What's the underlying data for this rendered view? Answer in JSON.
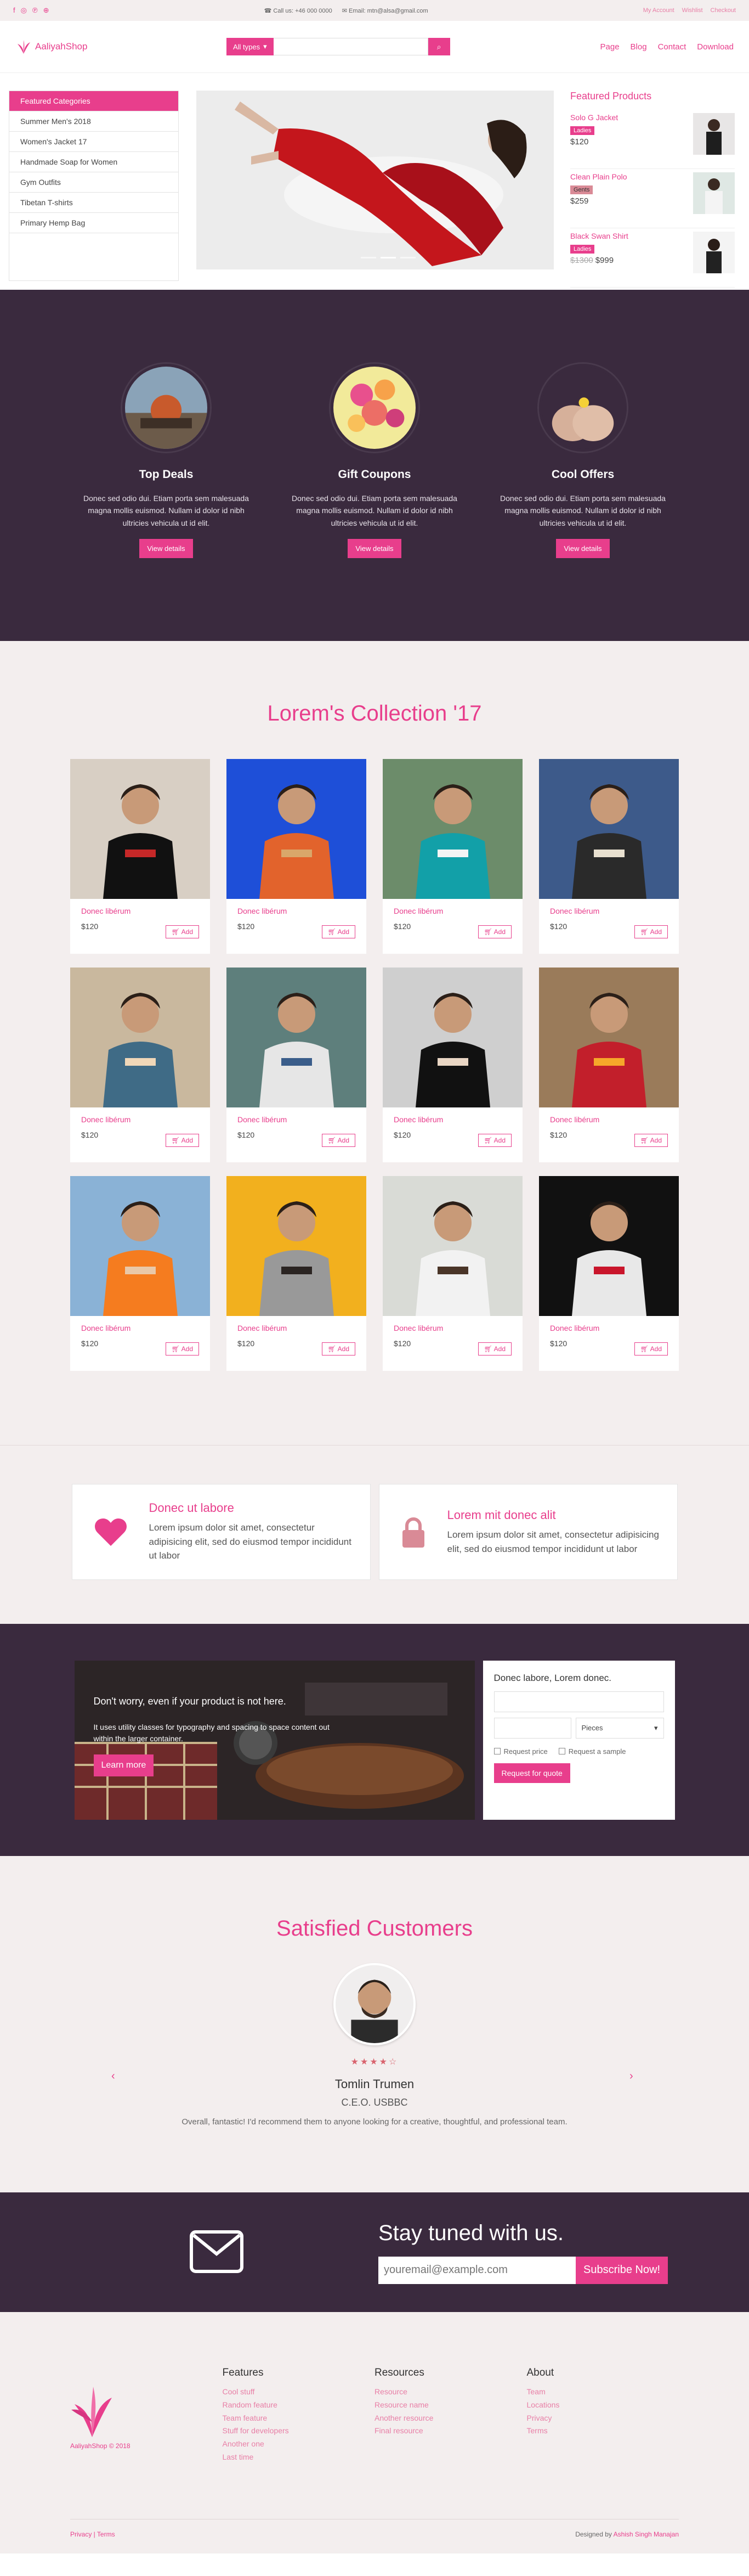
{
  "topbar": {
    "phone": "Call us: +46 000 0000",
    "email": "Email: mtn@alsa@gmail.com",
    "links": [
      "My Account",
      "Wishlist",
      "Checkout"
    ]
  },
  "header": {
    "logo": "AaliyahShop",
    "search_dropdown": "All types",
    "search_placeholder": "",
    "nav": [
      "Page",
      "Blog",
      "Contact",
      "Download"
    ]
  },
  "categories": {
    "items": [
      "Featured Categories",
      "Summer Men's 2018",
      "Women's Jacket 17",
      "Handmade Soap for Women",
      "Gym Outfits",
      "Tibetan T-shirts",
      "Primary Hemp Bag"
    ]
  },
  "featured": {
    "title": "Featured Products",
    "products": [
      {
        "name": "Solo G Jacket",
        "tag": "Ladies",
        "tag_color": "#e83e8c",
        "old_price": "",
        "price": "$120"
      },
      {
        "name": "Clean Plain Polo",
        "tag": "Gents",
        "tag_color": "#d98a96",
        "old_price": "",
        "price": "$259"
      },
      {
        "name": "Black Swan Shirt",
        "tag": "Ladies",
        "tag_color": "#e83e8c",
        "old_price": "$1300",
        "price": "$999"
      }
    ]
  },
  "deals": [
    {
      "title": "Top Deals",
      "text": "Donec sed odio dui. Etiam porta sem malesuada magna mollis euismod. Nullam id dolor id nibh ultricies vehicula ut id elit.",
      "button": "View details"
    },
    {
      "title": "Gift Coupons",
      "text": "Donec sed odio dui. Etiam porta sem malesuada magna mollis euismod. Nullam id dolor id nibh ultricies vehicula ut id elit.",
      "button": "View details"
    },
    {
      "title": "Cool Offers",
      "text": "Donec sed odio dui. Etiam porta sem malesuada magna mollis euismod. Nullam id dolor id nibh ultricies vehicula ut id elit.",
      "button": "View details"
    }
  ],
  "collection": {
    "title": "Lorem's Collection '17",
    "add_label": "Add",
    "items": [
      {
        "name": "Donec libérum",
        "price": "$120"
      },
      {
        "name": "Donec libérum",
        "price": "$120"
      },
      {
        "name": "Donec libérum",
        "price": "$120"
      },
      {
        "name": "Donec libérum",
        "price": "$120"
      },
      {
        "name": "Donec libérum",
        "price": "$120"
      },
      {
        "name": "Donec libérum",
        "price": "$120"
      },
      {
        "name": "Donec libérum",
        "price": "$120"
      },
      {
        "name": "Donec libérum",
        "price": "$120"
      },
      {
        "name": "Donec libérum",
        "price": "$120"
      },
      {
        "name": "Donec libérum",
        "price": "$120"
      },
      {
        "name": "Donec libérum",
        "price": "$120"
      },
      {
        "name": "Donec libérum",
        "price": "$120"
      }
    ]
  },
  "features": [
    {
      "title": "Donec ut labore",
      "text": "Lorem ipsum dolor sit amet, consectetur adipisicing elit, sed do eiusmod tempor incididunt ut labor",
      "icon": "heart-icon"
    },
    {
      "title": "Lorem mit donec alit",
      "text": "Lorem ipsum dolor sit amet, consectetur adipisicing elit, sed do eiusmod tempor incididunt ut labor",
      "icon": "lock-icon"
    }
  ],
  "promo": {
    "headline": "Don't worry, even if your product is not here.",
    "subtext": "It uses utility classes for typography and spacing to space content out within the larger container.",
    "button": "Learn more"
  },
  "quote_form": {
    "title": "Donec labore, Lorem donec.",
    "select_value": "Pieces",
    "check1": "Request price",
    "check2": "Request a sample",
    "button": "Request for quote"
  },
  "testimonial": {
    "title": "Satisfied Customers",
    "stars": "★★★★☆",
    "name": "Tomlin Trumen",
    "role": "C.E.O. USBBC",
    "quote": "Overall, fantastic! I'd recommend them to anyone looking for a creative, thoughtful, and professional team."
  },
  "newsletter": {
    "title": "Stay tuned with us.",
    "placeholder": "youremail@example.com",
    "button": "Subscribe Now!"
  },
  "footer": {
    "copyright": "AaliyahShop © 2018",
    "columns": [
      {
        "title": "Features",
        "links": [
          "Cool stuff",
          "Random feature",
          "Team feature",
          "Stuff for developers",
          "Another one",
          "Last time"
        ]
      },
      {
        "title": "Resources",
        "links": [
          "Resource",
          "Resource name",
          "Another resource",
          "Final resource"
        ]
      },
      {
        "title": "About",
        "links": [
          "Team",
          "Locations",
          "Privacy",
          "Terms"
        ]
      }
    ],
    "bottom_left": "Privacy | Terms",
    "designed_by": "Designed by",
    "designer": "Ashish Singh Manajan"
  }
}
